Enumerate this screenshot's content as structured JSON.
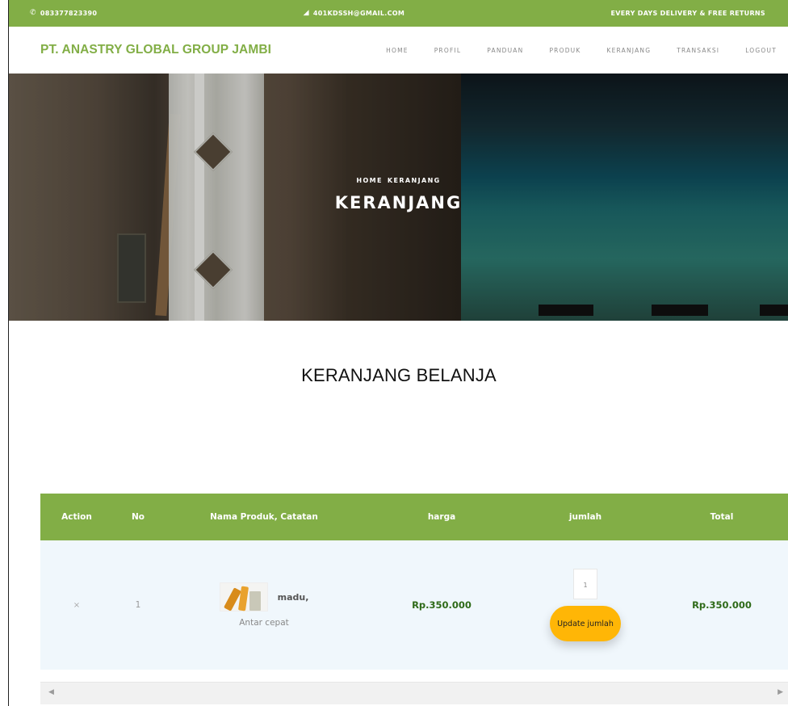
{
  "topbar": {
    "phone": "083377823390",
    "email": "401KDSSH@GMAIL.COM",
    "delivery": "EVERY DAYS DELIVERY & FREE RETURNS"
  },
  "brand": "PT. ANASTRY GLOBAL GROUP JAMBI",
  "nav": [
    "HOME",
    "PROFIL",
    "PANDUAN",
    "PRODUK",
    "KERANJANG",
    "TRANSAKSI",
    "LOGOUT"
  ],
  "hero": {
    "crumbs": [
      "HOME",
      "KERANJANG"
    ],
    "title": "KERANJANG"
  },
  "section_title": "KERANJANG BELANJA",
  "table": {
    "headers": [
      "Action",
      "No",
      "Nama Produk, Catatan",
      "harga",
      "jumlah",
      "Total"
    ],
    "rows": [
      {
        "action": "×",
        "no": "1",
        "product": "madu,",
        "note": "Antar cepat",
        "price": "Rp.350.000",
        "qty": "1",
        "update_label": "Update jumlah",
        "total": "Rp.350.000"
      }
    ]
  },
  "scrollbar": {
    "left_arrow": "◀",
    "right_arrow": "▶"
  },
  "colors": {
    "brand_green": "#82ae46",
    "accent_yellow": "#ffb606",
    "price_green": "#2e6a18"
  }
}
